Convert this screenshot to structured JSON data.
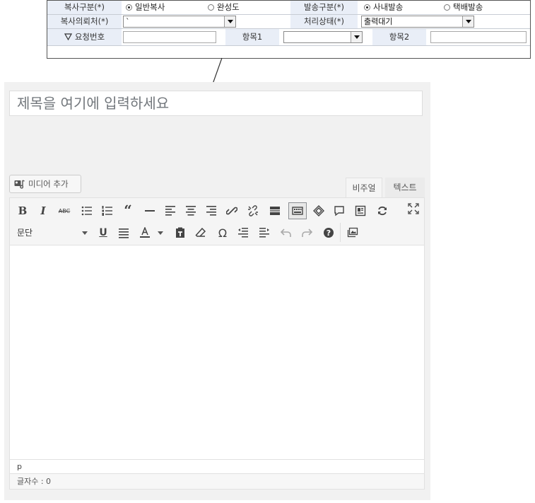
{
  "form": {
    "copy_type_label": "복사구분(*)",
    "copy_type_options": [
      "일반복사",
      "완성도"
    ],
    "send_type_label": "발송구분(*)",
    "send_type_options": [
      "사내발송",
      "택배발송"
    ],
    "requester_label": "복사의뢰처(*)",
    "requester_value": "`",
    "status_label": "처리상태(*)",
    "status_value": "출력대기",
    "request_no_label": "요청번호",
    "item1_label": "항목1",
    "item2_label": "항목2"
  },
  "editor": {
    "title_placeholder": "제목을 여기에 입력하세요",
    "media_button": "미디어 추가",
    "tab_visual": "비주얼",
    "tab_text": "텍스트",
    "format_select": "문단",
    "path": "p",
    "word_count": "글자수 : 0"
  },
  "colors": {
    "label_bg": "#e9eef7",
    "panel_bg": "#f1f1f1",
    "toolbar_bg": "#f5f5f5"
  }
}
